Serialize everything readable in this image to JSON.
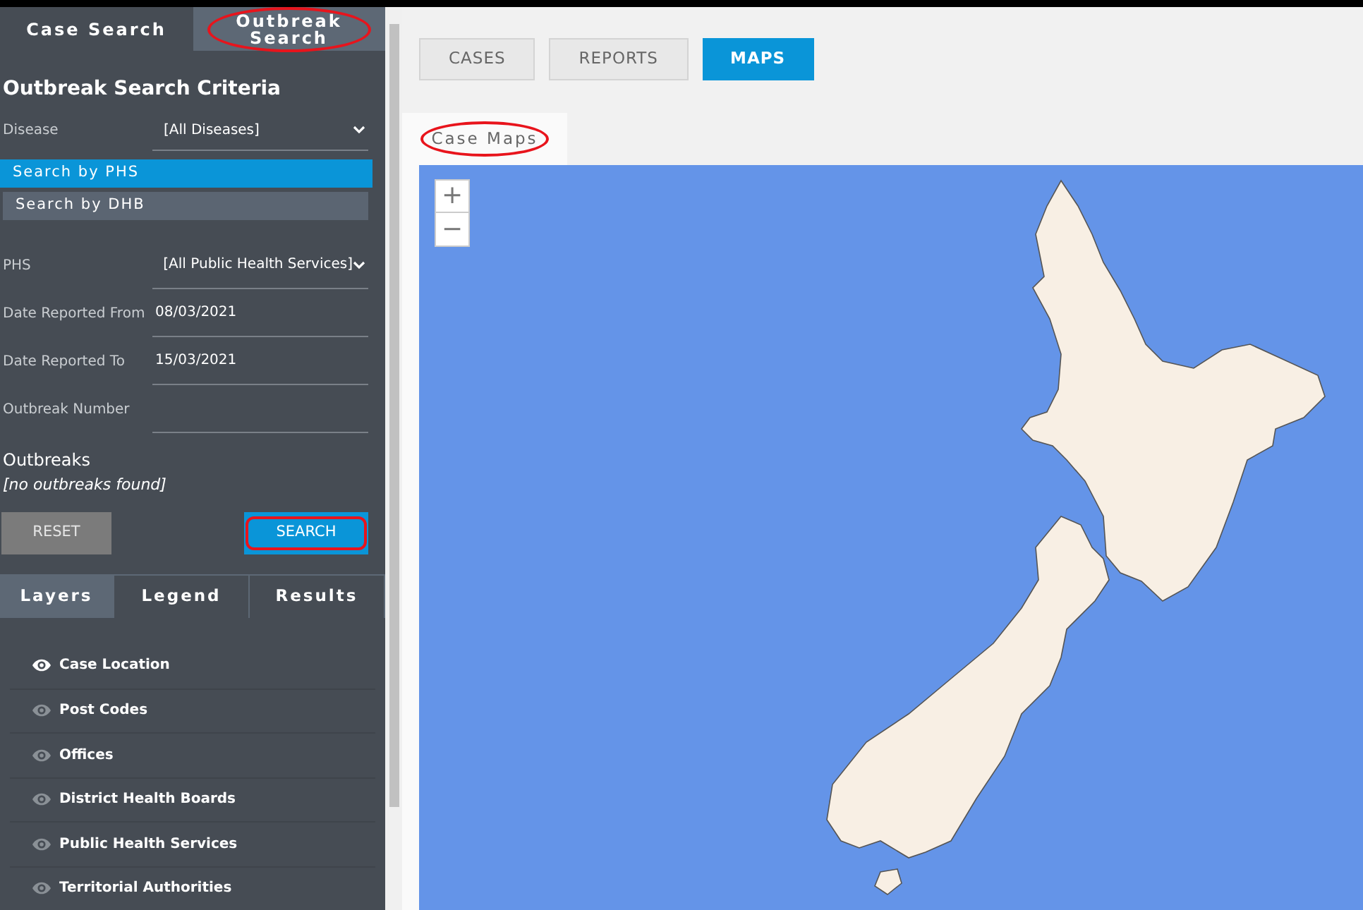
{
  "sidebar_tabs": [
    {
      "label": "Case Search",
      "selected": false,
      "highlighted": false
    },
    {
      "label": "Outbreak Search",
      "selected": true,
      "highlighted": true
    }
  ],
  "criteria": {
    "title": "Outbreak Search Criteria",
    "disease": {
      "label": "Disease",
      "value": "[All Diseases]"
    },
    "search_by": [
      {
        "label": "Search by PHS",
        "selected": true
      },
      {
        "label": "Search by DHB",
        "selected": false
      }
    ],
    "fields": [
      {
        "kind": "select",
        "label": "PHS",
        "value": "[All Public Health Services]"
      },
      {
        "kind": "input",
        "label": "Date Reported From",
        "value": "08/03/2021"
      },
      {
        "kind": "input",
        "label": "Date Reported To",
        "value": "15/03/2021"
      },
      {
        "kind": "input",
        "label": "Outbreak Number"
      }
    ],
    "outbreaks": {
      "title": "Outbreaks",
      "empty_text": "[no outbreaks found]"
    },
    "reset_button": "RESET",
    "search_button": {
      "label": "SEARCH",
      "highlighted": true
    }
  },
  "panel_tabs": [
    {
      "label": "Layers",
      "selected": true
    },
    {
      "label": "Legend",
      "selected": false
    },
    {
      "label": "Results",
      "selected": false
    }
  ],
  "layers": [
    {
      "label": "Case Location",
      "visible": true
    },
    {
      "label": "Post Codes",
      "visible": false
    },
    {
      "label": "Offices",
      "visible": false
    },
    {
      "label": "District Health Boards",
      "visible": false
    },
    {
      "label": "Public Health Services",
      "visible": false
    },
    {
      "label": "Territorial Authorities",
      "visible": false
    }
  ],
  "main_tabs": [
    {
      "label": "CASES",
      "selected": false
    },
    {
      "label": "REPORTS",
      "selected": false
    },
    {
      "label": "MAPS",
      "selected": true
    }
  ],
  "sub_tab": {
    "label": "Case Maps",
    "highlighted": true
  },
  "map": {
    "zoom_in": "+",
    "zoom_out": "−"
  }
}
